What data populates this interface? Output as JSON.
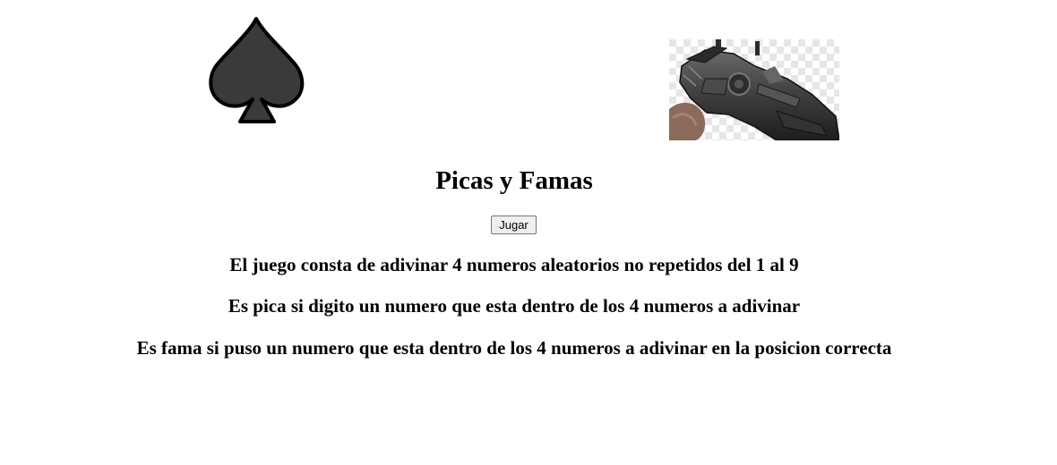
{
  "header": {
    "left_icon": "spade-icon",
    "right_image": "weapon-image"
  },
  "main": {
    "title": "Picas y Famas",
    "play_button_label": "Jugar",
    "rules": [
      "El juego consta de adivinar 4 numeros aleatorios no repetidos del 1 al 9",
      "Es pica si digito un numero que esta dentro de los 4 numeros a adivinar",
      "Es fama si puso un numero que esta dentro de los 4 numeros a adivinar en la posicion correcta"
    ]
  },
  "colors": {
    "background": "#ffffff",
    "spade_fill": "#3a3a3a",
    "spade_stroke": "#000000",
    "text": "#000000",
    "button_bg": "#efefef",
    "button_border": "#767676"
  }
}
